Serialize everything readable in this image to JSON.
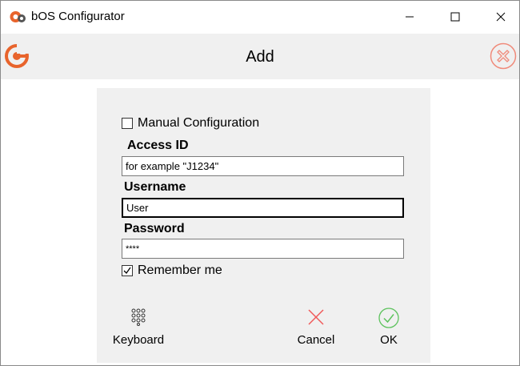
{
  "window": {
    "title": "bOS Configurator"
  },
  "header": {
    "title": "Add"
  },
  "form": {
    "manual_configuration": {
      "label": "Manual Configuration",
      "checked": false
    },
    "access_id": {
      "label": "Access ID",
      "value": "for example \"J1234\""
    },
    "username": {
      "label": "Username",
      "value": "User"
    },
    "password": {
      "label": "Password",
      "value": "****"
    },
    "remember_me": {
      "label": "Remember me",
      "checked": true
    }
  },
  "actions": {
    "keyboard": "Keyboard",
    "cancel": "Cancel",
    "ok": "OK"
  },
  "colors": {
    "brand_orange": "#e8642c",
    "cancel_red": "#f05a5a",
    "ok_green": "#5cc25c",
    "header_close": "#f08a7a"
  },
  "icons": {
    "app": "bos-gear-icon",
    "header_logo": "bos-logo-icon",
    "header_close": "close-circle-icon",
    "keyboard": "keypad-icon",
    "cancel": "x-icon",
    "ok": "check-circle-icon"
  }
}
